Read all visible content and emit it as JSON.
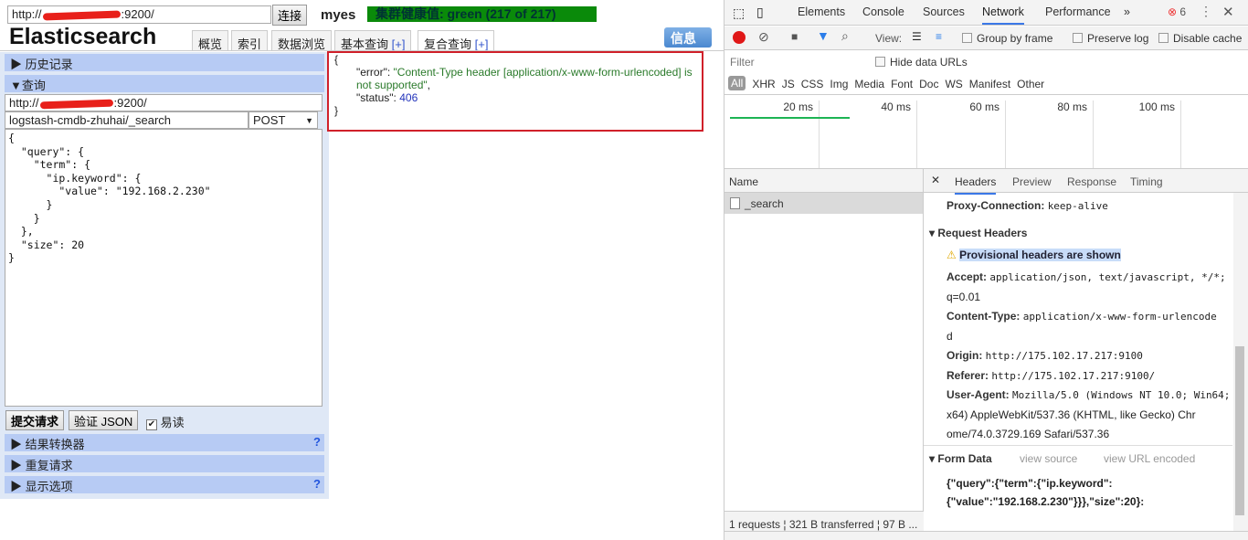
{
  "es": {
    "url_prefix": "http://",
    "url_suffix": ":9200/",
    "connect": "连接",
    "cluster_name": "myes",
    "health": "集群健康值: green (217 of 217)",
    "title": "Elasticsearch",
    "tabs": [
      {
        "label": "概览"
      },
      {
        "label": "索引"
      },
      {
        "label": "数据浏览"
      },
      {
        "label": "基本查询",
        "plus": "[+]"
      },
      {
        "label": "复合查询",
        "plus": "[+]"
      }
    ],
    "info": "信息",
    "history": "历史记录",
    "query": "查询",
    "query_url_prefix": "http://",
    "query_url_suffix": ":9200/",
    "path": "logstash-cmdb-zhuhai/_search",
    "method": "POST",
    "body": "{\n  \"query\": {\n    \"term\": {\n      \"ip.keyword\": {\n        \"value\": \"192.168.2.230\"\n      }\n    }\n  },\n  \"size\": 20\n}",
    "submit": "提交请求",
    "validate": "验证 JSON",
    "pretty": "易读",
    "pretty_checked": true,
    "sections": [
      {
        "label": "结果转换器",
        "help": "?"
      },
      {
        "label": "重复请求"
      },
      {
        "label": "显示选项",
        "help": "?"
      }
    ],
    "result": {
      "open": "{",
      "error_key": "\"error\"",
      "error_val": "\"Content-Type header [application/x-www-form-urlencoded] is not supported\"",
      "status_key": "\"status\"",
      "status_val": "406",
      "close": "}"
    }
  },
  "devtools": {
    "tabs": [
      "Elements",
      "Console",
      "Sources",
      "Network",
      "Performance",
      "»"
    ],
    "active_tab": "Network",
    "errors": "6",
    "view": "View:",
    "group_by_frame": "Group by frame",
    "preserve_log": "Preserve log",
    "disable_cache": "Disable cache",
    "filter_placeholder": "Filter",
    "hide_data_urls": "Hide data URLs",
    "types": [
      "All",
      "XHR",
      "JS",
      "CSS",
      "Img",
      "Media",
      "Font",
      "Doc",
      "WS",
      "Manifest",
      "Other"
    ],
    "timeline": [
      "20 ms",
      "40 ms",
      "60 ms",
      "80 ms",
      "100 ms"
    ],
    "name_header": "Name",
    "request": "_search",
    "detail_tabs": [
      "Headers",
      "Preview",
      "Response",
      "Timing"
    ],
    "proxy": {
      "k": "Proxy-Connection:",
      "v": "keep-alive"
    },
    "request_headers": "Request Headers",
    "provisional": "Provisional headers are shown",
    "headers": [
      {
        "k": "Accept:",
        "v": "application/json, text/javascript, */*;",
        "v2": "q=0.01"
      },
      {
        "k": "Content-Type:",
        "v": "application/x-www-form-urlencode",
        "v2": "d"
      },
      {
        "k": "Origin:",
        "v": "http://175.102.17.217:9100"
      },
      {
        "k": "Referer:",
        "v": "http://175.102.17.217:9100/"
      },
      {
        "k": "User-Agent:",
        "v": "Mozilla/5.0 (Windows NT 10.0; Win64;",
        "v2": "x64) AppleWebKit/537.36 (KHTML, like Gecko) Chr",
        "v3": "ome/74.0.3729.169 Safari/537.36"
      }
    ],
    "form_data": "Form Data",
    "view_source": "view source",
    "view_url_encoded": "view URL encoded",
    "form_line1": "{\"query\":{\"term\":{\"ip.keyword\":",
    "form_line2": "{\"value\":\"192.168.2.230\"}}},\"size\":20}:",
    "status": "1 requests  ¦  321 B transferred  ¦  97 B ..."
  }
}
